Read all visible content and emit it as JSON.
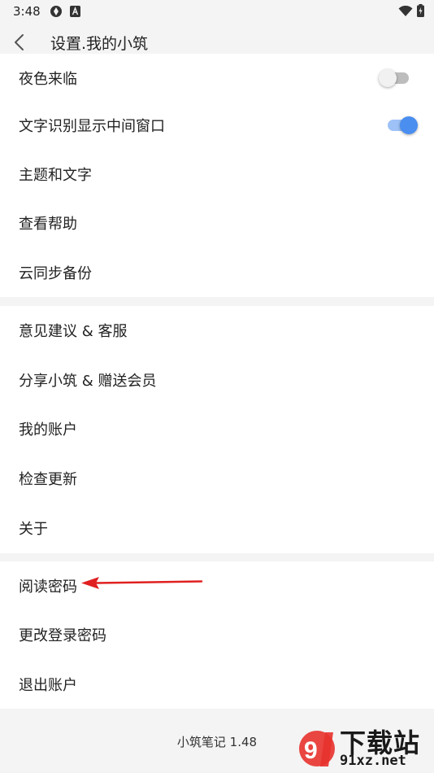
{
  "status_bar": {
    "time": "3:48",
    "icons": [
      "app-notification-icon",
      "a-notification-icon",
      "wifi-icon",
      "battery-icon"
    ]
  },
  "header": {
    "title": "设置.我的小筑",
    "back_icon": "back-arrow-icon"
  },
  "settings": {
    "group1": [
      {
        "label": "夜色来临",
        "toggle": "off"
      },
      {
        "label": "文字识别显示中间窗口",
        "toggle": "on"
      },
      {
        "label": "主题和文字"
      },
      {
        "label": "查看帮助"
      },
      {
        "label": "云同步备份"
      }
    ],
    "group2": [
      {
        "label": "意见建议 & 客服"
      },
      {
        "label": "分享小筑 & 赠送会员"
      },
      {
        "label": "我的账户"
      },
      {
        "label": "检查更新"
      },
      {
        "label": "关于"
      }
    ],
    "group3": [
      {
        "label": "阅读密码"
      },
      {
        "label": "更改登录密码"
      },
      {
        "label": "退出账户"
      }
    ]
  },
  "footer": {
    "version": "小筑笔记 1.48"
  },
  "watermark": {
    "brand": "下载站",
    "domain": "91xz.net"
  },
  "colors": {
    "accent": "#4a8ef0",
    "annotation": "#e02020"
  }
}
